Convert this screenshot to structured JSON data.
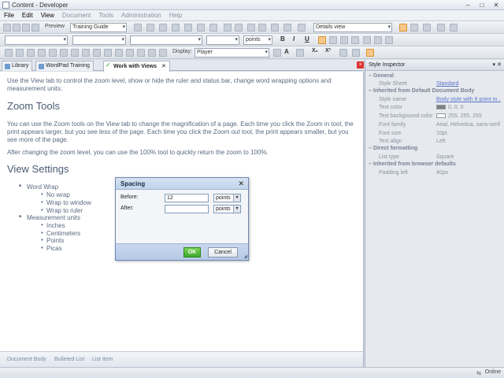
{
  "window": {
    "title": "Content - Developer",
    "minimize": "–",
    "maximize": "□",
    "close": "✕"
  },
  "menu": [
    {
      "label": "File",
      "state": "active"
    },
    {
      "label": "Edit",
      "state": "active"
    },
    {
      "label": "View",
      "state": "active"
    },
    {
      "label": "Document",
      "state": "disabled"
    },
    {
      "label": "Tools",
      "state": "disabled"
    },
    {
      "label": "Administration",
      "state": "disabled"
    },
    {
      "label": "Help",
      "state": "disabled"
    }
  ],
  "toolbar": {
    "preview_label": "Preview",
    "template_value": "Training Guide",
    "view_value": "Details view",
    "style_value": "",
    "font_value": "",
    "size_value": "",
    "units_value": "points",
    "bold": "B",
    "italic": "I",
    "underline": "U",
    "display_label": "Display:",
    "display_value": "Player",
    "text_a": "A",
    "subscript": "X₂",
    "superscript": "X²"
  },
  "tabs": [
    {
      "label": "Library",
      "icon": "library-icon",
      "active": false
    },
    {
      "label": "WordPad Training",
      "icon": "document-icon",
      "active": false
    },
    {
      "label": "Work with Views",
      "icon": "check-icon",
      "active": true
    }
  ],
  "tab_close": "✕",
  "document": {
    "intro": "Use the View tab to control the zoom level, show or hide the ruler and status bar, change word wrapping options and measurement units.",
    "zoom_heading": "Zoom Tools",
    "zoom_p1": "You can use the Zoom tools on the View tab to change the magnification of a page. Each time you click the Zoom in tool, the print appears larger, but you see less of the page. Each time you click the Zoom out tool, the print appears smaller, but you see more of the page.",
    "zoom_p2": "After changing the zoom level, you can use the 100% tool to quickly return the zoom to 100%.",
    "view_heading": "View Settings",
    "list": {
      "word_wrap": "Word Wrap",
      "no_wrap": "No wrap",
      "wrap_window": "Wrap to window",
      "wrap_ruler": "Wrap to ruler",
      "units": "Measurement units",
      "inches": "Inches",
      "centimeters": "Centimeters",
      "points": "Points",
      "picas": "Picas"
    }
  },
  "breadcrumb": [
    "Document Body",
    "Bulleted List",
    "List Item"
  ],
  "inspector": {
    "title": "Style Inspector",
    "pin": "📌",
    "close": "✕",
    "groups": {
      "general": "General",
      "inherited_doc": "Inherited from Default Document Body",
      "direct": "Direct formatting",
      "inherited_browser": "Inherited from browser defaults"
    },
    "rows": {
      "style_sheet_k": "Style Sheet",
      "style_sheet_v": "Standard",
      "style_name_k": "Style name",
      "style_name_v": "Body style with 8 point m...",
      "text_color_k": "Text color",
      "text_color_v": "0, 0, 0",
      "text_bg_k": "Text background color",
      "text_bg_v": "255, 255, 255",
      "font_family_k": "Font family",
      "font_family_v": "Arial, Helvetica, sans-serif",
      "font_size_k": "Font size",
      "font_size_v": "10pt",
      "text_align_k": "Text align",
      "text_align_v": "Left",
      "list_type_k": "List type",
      "list_type_v": "Square",
      "padding_left_k": "Padding left",
      "padding_left_v": "40px"
    },
    "colors": {
      "text_color": "#808080",
      "text_bg": "#ffffff"
    }
  },
  "status": {
    "online": "Online"
  },
  "dialog": {
    "title": "Spacing",
    "close": "✕",
    "before_label": "Before:",
    "before_value": "12",
    "before_units": "points",
    "after_label": "After:",
    "after_value": "",
    "after_units": "points",
    "ok": "OK",
    "cancel": "Cancel"
  },
  "colors": {
    "accent": "#d9942f",
    "ok_green": "#3ca82a",
    "link": "#5b77c9"
  }
}
